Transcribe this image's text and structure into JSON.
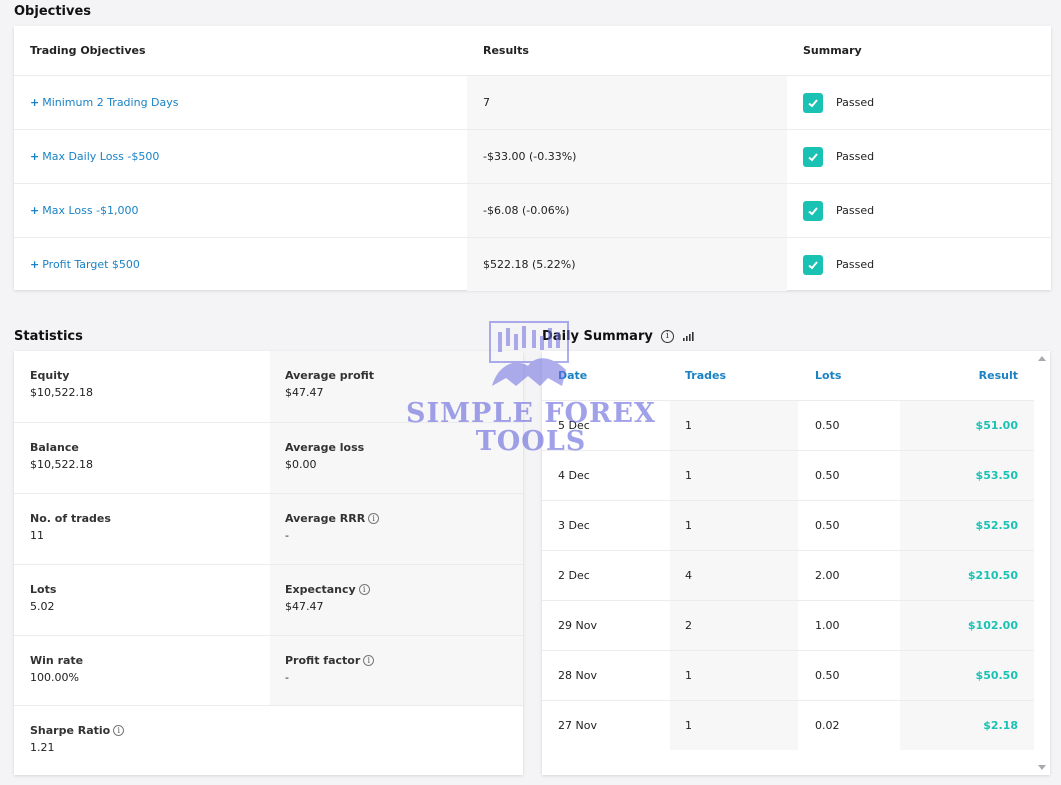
{
  "objectives": {
    "title": "Objectives",
    "headers": {
      "objective": "Trading Objectives",
      "results": "Results",
      "summary": "Summary"
    },
    "rows": [
      {
        "objective": "Minimum 2 Trading Days",
        "result": "7",
        "summary": "Passed"
      },
      {
        "objective": "Max Daily Loss -$500",
        "result": "-$33.00 (-0.33%)",
        "summary": "Passed"
      },
      {
        "objective": "Max Loss -$1,000",
        "result": "-$6.08 (-0.06%)",
        "summary": "Passed"
      },
      {
        "objective": "Profit Target $500",
        "result": "$522.18 (5.22%)",
        "summary": "Passed"
      }
    ]
  },
  "statistics": {
    "title": "Statistics",
    "equity": {
      "label": "Equity",
      "value": "$10,522.18"
    },
    "average_profit": {
      "label": "Average profit",
      "value": "$47.47"
    },
    "balance": {
      "label": "Balance",
      "value": "$10,522.18"
    },
    "average_loss": {
      "label": "Average loss",
      "value": "$0.00"
    },
    "no_of_trades": {
      "label": "No. of trades",
      "value": "11"
    },
    "average_rrr": {
      "label": "Average RRR",
      "value": "-"
    },
    "lots": {
      "label": "Lots",
      "value": "5.02"
    },
    "expectancy": {
      "label": "Expectancy",
      "value": "$47.47"
    },
    "win_rate": {
      "label": "Win rate",
      "value": "100.00%"
    },
    "profit_factor": {
      "label": "Profit factor",
      "value": "-"
    },
    "sharpe_ratio": {
      "label": "Sharpe Ratio",
      "value": "1.21"
    }
  },
  "daily_summary": {
    "title": "Daily Summary",
    "headers": {
      "date": "Date",
      "trades": "Trades",
      "lots": "Lots",
      "result": "Result"
    },
    "rows": [
      {
        "date": "5 Dec",
        "trades": "1",
        "lots": "0.50",
        "result": "$51.00"
      },
      {
        "date": "4 Dec",
        "trades": "1",
        "lots": "0.50",
        "result": "$53.50"
      },
      {
        "date": "3 Dec",
        "trades": "1",
        "lots": "0.50",
        "result": "$52.50"
      },
      {
        "date": "2 Dec",
        "trades": "4",
        "lots": "2.00",
        "result": "$210.50"
      },
      {
        "date": "29 Nov",
        "trades": "2",
        "lots": "1.00",
        "result": "$102.00"
      },
      {
        "date": "28 Nov",
        "trades": "1",
        "lots": "0.50",
        "result": "$50.50"
      },
      {
        "date": "27 Nov",
        "trades": "1",
        "lots": "0.02",
        "result": "$2.18"
      }
    ]
  },
  "watermark": {
    "line1": "SIMPLE FOREX",
    "line2": "TOOLS"
  },
  "icons": {
    "info": "info-icon",
    "chart": "bar-chart-icon",
    "check": "check-icon",
    "plus": "plus-icon"
  },
  "colors": {
    "accent_blue": "#1a82c4",
    "positive_green": "#19c2b3",
    "negative_red": "#e2394a",
    "check_bg": "#19c2b3"
  }
}
